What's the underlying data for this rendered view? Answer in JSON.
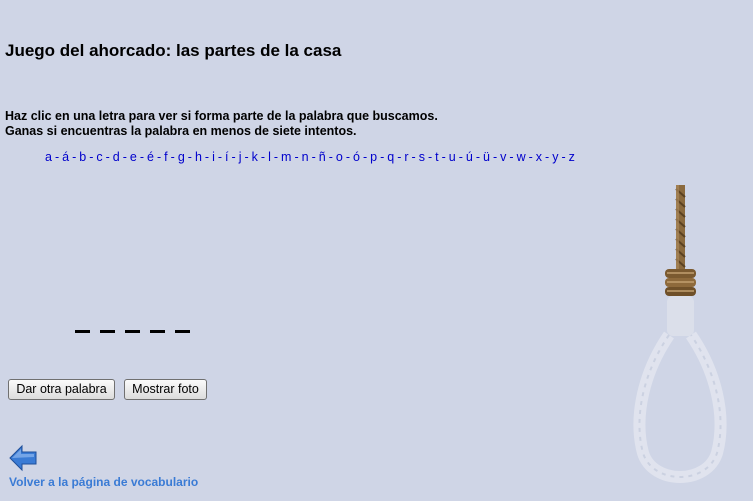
{
  "title": "Juego del ahorcado: las partes de la casa",
  "instructions": {
    "line1": "Haz clic en una letra para ver si forma parte de la palabra que buscamos.",
    "line2": "Ganas si encuentras la palabra en menos de siete intentos."
  },
  "letters": [
    "a",
    "á",
    "b",
    "c",
    "d",
    "e",
    "é",
    "f",
    "g",
    "h",
    "i",
    "í",
    "j",
    "k",
    "l",
    "m",
    "n",
    "ñ",
    "o",
    "ó",
    "p",
    "q",
    "r",
    "s",
    "t",
    "u",
    "ú",
    "ü",
    "v",
    "w",
    "x",
    "y",
    "z"
  ],
  "word_blanks": 5,
  "buttons": {
    "new_word": "Dar otra palabra",
    "show_photo": "Mostrar foto"
  },
  "back_link": "Volver a la página de vocabulario",
  "icons": {
    "back": "arrow-left-icon",
    "noose": "noose-image"
  },
  "colors": {
    "background": "#cfd5e6",
    "letter_link": "#0000cc",
    "back_link": "#3a7bd5"
  }
}
